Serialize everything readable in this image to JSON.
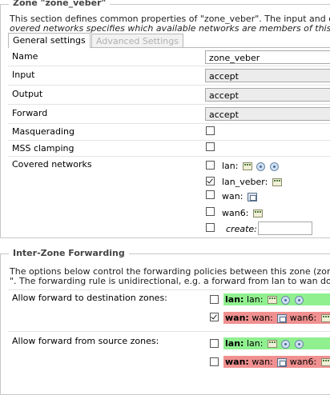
{
  "zone_section": {
    "legend": "Zone \"zone_veber\"",
    "desc_line1": "This section defines common properties of \"zone_veber\". The input and output options",
    "desc_line2": "overed networks specifies which available networks are members of this zone.",
    "tabs": [
      {
        "label": "General settings",
        "active": true
      },
      {
        "label": "Advanced Settings",
        "active": false
      }
    ],
    "fields": {
      "name": {
        "label": "Name",
        "value": "zone_veber"
      },
      "input": {
        "label": "Input",
        "value": "accept"
      },
      "output": {
        "label": "Output",
        "value": "accept"
      },
      "forward": {
        "label": "Forward",
        "value": "accept"
      },
      "masquerading": {
        "label": "Masquerading",
        "checked": false
      },
      "mss_clamping": {
        "label": "MSS clamping",
        "checked": false
      },
      "covered_networks": {
        "label": "Covered networks"
      }
    },
    "networks": [
      {
        "name": "lan:",
        "checked": false,
        "icons": [
          "ethernet-icon",
          "wifi-icon",
          "wifi-icon"
        ]
      },
      {
        "name": "lan_veber:",
        "checked": true,
        "icons": [
          "ethernet-icon"
        ]
      },
      {
        "name": "wan:",
        "checked": false,
        "icons": [
          "vnet-icon"
        ]
      },
      {
        "name": "wan6:",
        "checked": false,
        "icons": [
          "ethernet-icon"
        ]
      },
      {
        "name": "create:",
        "checked": false,
        "icons": []
      }
    ]
  },
  "forwarding_section": {
    "legend": "Inter-Zone Forwarding",
    "desc_line1": "The options below control the forwarding policies between this zone (zone_veber) and",
    "desc_line2": "\". The forwarding rule is unidirectional, e.g. a forward from lan to wan does not imply",
    "dest_label": "Allow forward to destination zones:",
    "src_label": "Allow forward from source zones:",
    "dest_zones": [
      {
        "zone": "lan:",
        "nets": "lan:",
        "color": "#90f090",
        "checked": false
      },
      {
        "zone": "wan:",
        "nets": "wan: ",
        "nets2": " wan6:",
        "color": "#f09090",
        "checked": true
      }
    ],
    "src_zones": [
      {
        "zone": "lan:",
        "nets": "lan:",
        "color": "#90f090",
        "checked": false
      },
      {
        "zone": "wan:",
        "nets": "wan: ",
        "nets2": " wan6:",
        "color": "#f09090",
        "checked": false
      }
    ]
  }
}
